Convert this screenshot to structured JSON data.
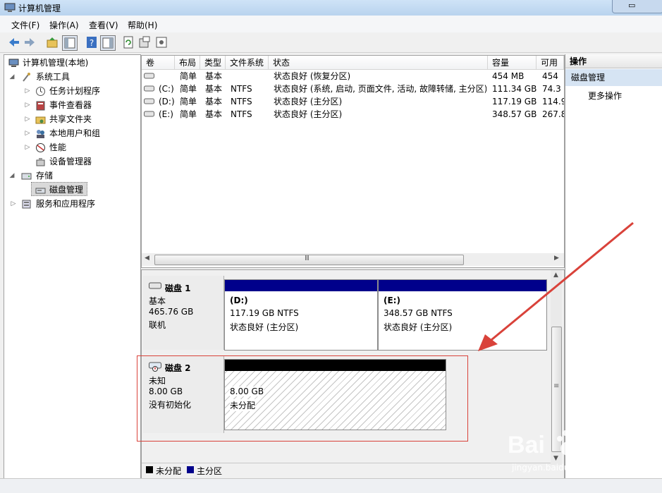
{
  "window": {
    "title": "计算机管理"
  },
  "menu": [
    "文件(F)",
    "操作(A)",
    "查看(V)",
    "帮助(H)"
  ],
  "tree": {
    "root": "计算机管理(本地)",
    "system_tools": "系统工具",
    "task_scheduler": "任务计划程序",
    "event_viewer": "事件查看器",
    "shared_folders": "共享文件夹",
    "local_users": "本地用户和组",
    "performance": "性能",
    "device_manager": "设备管理器",
    "storage": "存储",
    "disk_management": "磁盘管理",
    "services_apps": "服务和应用程序"
  },
  "volume_table": {
    "headers": [
      "卷",
      "布局",
      "类型",
      "文件系统",
      "状态",
      "容量",
      "可用"
    ],
    "rows": [
      [
        "",
        "简单",
        "基本",
        "",
        "状态良好 (恢复分区)",
        "454 MB",
        "454"
      ],
      [
        "(C:)",
        "简单",
        "基本",
        "NTFS",
        "状态良好 (系统, 启动, 页面文件, 活动, 故障转储, 主分区)",
        "111.34 GB",
        "74.3"
      ],
      [
        "(D:)",
        "简单",
        "基本",
        "NTFS",
        "状态良好 (主分区)",
        "117.19 GB",
        "114.9"
      ],
      [
        "(E:)",
        "简单",
        "基本",
        "NTFS",
        "状态良好 (主分区)",
        "348.57 GB",
        "267.8"
      ]
    ]
  },
  "scroll_glyph": "Ⅲ",
  "vscroll_glyph": "≡",
  "disks": [
    {
      "name": "磁盘 1",
      "type": "基本",
      "size": "465.76 GB",
      "status": "联机",
      "partitions": [
        {
          "label": "(D:)",
          "size": "117.19 GB NTFS",
          "status": "状态良好 (主分区)"
        },
        {
          "label": "(E:)",
          "size": "348.57 GB NTFS",
          "status": "状态良好 (主分区)"
        }
      ]
    },
    {
      "name": "磁盘 2",
      "type": "未知",
      "size": "8.00 GB",
      "status": "没有初始化",
      "partitions": [
        {
          "size": "8.00 GB",
          "status": "未分配"
        }
      ]
    }
  ],
  "legend": [
    "未分配",
    "主分区"
  ],
  "actions": {
    "header": "操作",
    "selected": "磁盘管理",
    "more": "更多操作"
  },
  "watermark": {
    "brand": "Bai",
    "brand2": "经验",
    "url": "jingyan.baidu.com"
  },
  "colors": {
    "primary_partition": "#00008b",
    "unallocated": "#000000",
    "highlight": "#d9423a",
    "selection": "#d6e4f3"
  }
}
